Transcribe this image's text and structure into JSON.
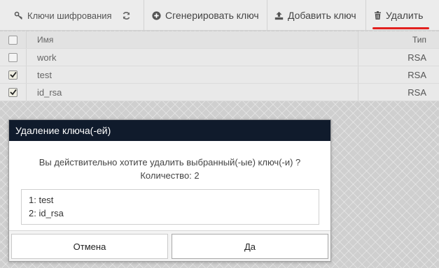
{
  "toolbar": {
    "title": "Ключи шифрования",
    "generate_label": "Сгенерировать ключ",
    "add_label": "Добавить ключ",
    "delete_label": "Удалить",
    "accent_color": "#e2201e"
  },
  "table": {
    "columns": {
      "name": "Имя",
      "type": "Тип"
    },
    "rows": [
      {
        "name": "work",
        "type": "RSA",
        "checked": false
      },
      {
        "name": "test",
        "type": "RSA",
        "checked": true
      },
      {
        "name": "id_rsa",
        "type": "RSA",
        "checked": true
      }
    ]
  },
  "dialog": {
    "title": "Удаление ключа(-ей)",
    "question": "Вы действительно хотите удалить выбранный(-ые) ключ(-и) ?",
    "count_text": "Количество: 2",
    "items": [
      "1: test",
      "2: id_rsa"
    ],
    "cancel_label": "Отмена",
    "confirm_label": "Да",
    "header_color": "#101b2c"
  }
}
